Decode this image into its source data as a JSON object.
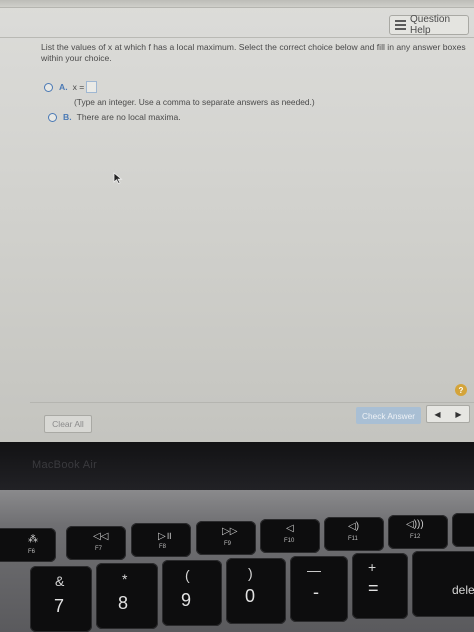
{
  "screen": {
    "help_button": "Question Help",
    "question": "List the values of x at which f has a local maximum. Select the correct choice below and fill in any answer boxes within your choice.",
    "option_a": {
      "letter": "A.",
      "text": "x ="
    },
    "hint": "(Type an integer. Use a comma to separate answers as needed.)",
    "option_b": {
      "letter": "B.",
      "text": "There are no local maxima."
    },
    "help_circle": "?",
    "clear_button": "Clear All",
    "check_button": "Check Answer",
    "nav_prev": "◀",
    "nav_next": "▶"
  },
  "laptop": {
    "brand": "MacBook Air",
    "function_keys": [
      {
        "label": "F6",
        "icon": "keyboard-backlight-icon"
      },
      {
        "label": "F7",
        "icon": "rewind-icon"
      },
      {
        "label": "F8",
        "icon": "play-pause-icon"
      },
      {
        "label": "F9",
        "icon": "fast-forward-icon"
      },
      {
        "label": "F10",
        "icon": "mute-icon"
      },
      {
        "label": "F11",
        "icon": "volume-down-icon"
      },
      {
        "label": "F12",
        "icon": "volume-up-icon"
      }
    ],
    "number_keys": [
      {
        "top": "&",
        "bottom": "7"
      },
      {
        "top": "*",
        "bottom": "8"
      },
      {
        "top": "(",
        "bottom": "9"
      },
      {
        "top": ")",
        "bottom": "0"
      },
      {
        "top": "—",
        "bottom": "-"
      },
      {
        "top": "+",
        "bottom": "="
      }
    ],
    "delete_key": "dele"
  }
}
